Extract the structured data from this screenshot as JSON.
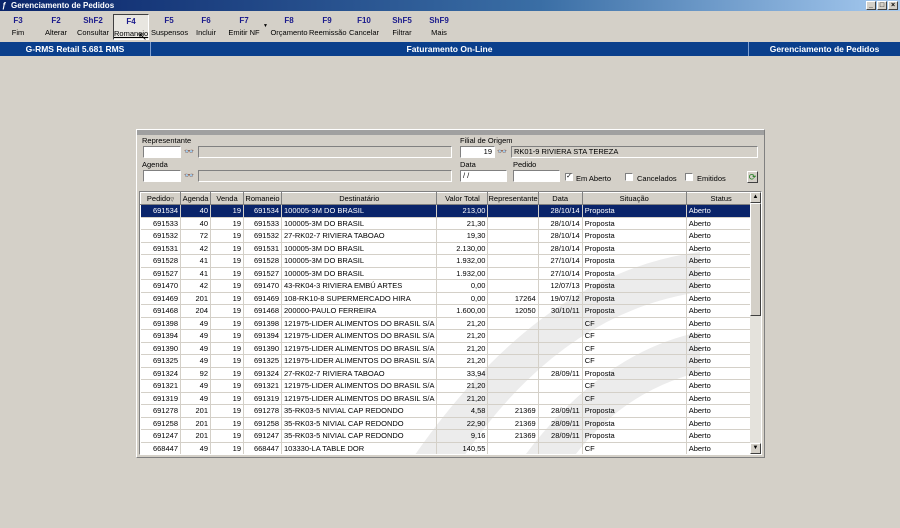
{
  "window": {
    "title": "Gerenciamento de Pedidos",
    "min": "_",
    "max": "□",
    "close": "×"
  },
  "toolbar": [
    {
      "key": "F3",
      "label": "Fim"
    },
    {
      "key": "F2",
      "label": "Alterar"
    },
    {
      "key": "ShF2",
      "label": "Consultar"
    },
    {
      "key": "F4",
      "label": "Romaneio"
    },
    {
      "key": "F5",
      "label": "Suspensos"
    },
    {
      "key": "F6",
      "label": "Incluir"
    },
    {
      "key": "F7",
      "label": "Emitir NF"
    },
    {
      "key": "F8",
      "label": "Orçamento"
    },
    {
      "key": "F9",
      "label": "Reemissão"
    },
    {
      "key": "F10",
      "label": "Cancelar"
    },
    {
      "key": "ShF5",
      "label": "Filtrar"
    },
    {
      "key": "ShF9",
      "label": "Mais"
    }
  ],
  "infobar": {
    "left": "G-RMS Retail 5.681 RMS",
    "center": "Faturamento On-Line",
    "right": "Gerenciamento de Pedidos"
  },
  "filters": {
    "representante_label": "Representante",
    "representante_value": "",
    "filial_label": "Filial de Origem",
    "filial_value": "19",
    "filial_desc": "RK01-9 RIVIERA STA TEREZA",
    "agenda_label": "Agenda",
    "agenda_value": "",
    "data_label": "Data",
    "data_value": " / /",
    "pedido_label": "Pedido",
    "pedido_value": "",
    "em_aberto_label": "Em Aberto",
    "em_aberto_checked": "✓",
    "cancelados_label": "Cancelados",
    "emitidos_label": "Emitidos"
  },
  "grid": {
    "columns": [
      "Pedido",
      "Agenda",
      "Venda",
      "Romaneio",
      "Destinatário",
      "Valor Total",
      "Representante",
      "Data",
      "Situação",
      "Status"
    ],
    "sort_indicator": "▽",
    "rows": [
      [
        "691534",
        "40",
        "19",
        "691534",
        "100005-3M DO BRASIL",
        "213,00",
        "",
        "28/10/14",
        "Proposta",
        "Aberto"
      ],
      [
        "691533",
        "40",
        "19",
        "691533",
        "100005-3M DO BRASIL",
        "21,30",
        "",
        "28/10/14",
        "Proposta",
        "Aberto"
      ],
      [
        "691532",
        "72",
        "19",
        "691532",
        "27-RK02-7 RIVIERA TABOAO",
        "19,30",
        "",
        "28/10/14",
        "Proposta",
        "Aberto"
      ],
      [
        "691531",
        "42",
        "19",
        "691531",
        "100005-3M DO BRASIL",
        "2.130,00",
        "",
        "28/10/14",
        "Proposta",
        "Aberto"
      ],
      [
        "691528",
        "41",
        "19",
        "691528",
        "100005-3M DO BRASIL",
        "1.932,00",
        "",
        "27/10/14",
        "Proposta",
        "Aberto"
      ],
      [
        "691527",
        "41",
        "19",
        "691527",
        "100005-3M DO BRASIL",
        "1.932,00",
        "",
        "27/10/14",
        "Proposta",
        "Aberto"
      ],
      [
        "691470",
        "42",
        "19",
        "691470",
        "43-RK04-3 RIVIERA EMBÚ ARTES",
        "0,00",
        "",
        "12/07/13",
        "Proposta",
        "Aberto"
      ],
      [
        "691469",
        "201",
        "19",
        "691469",
        "108-RK10-8 SUPERMERCADO HIRA",
        "0,00",
        "17264",
        "19/07/12",
        "Proposta",
        "Aberto"
      ],
      [
        "691468",
        "204",
        "19",
        "691468",
        "200000-PAULO FERREIRA",
        "1.600,00",
        "12050",
        "30/10/11",
        "Proposta",
        "Aberto"
      ],
      [
        "691398",
        "49",
        "19",
        "691398",
        "121975-LIDER ALIMENTOS DO BRASIL S/A",
        "21,20",
        "",
        "",
        "CF",
        "Aberto"
      ],
      [
        "691394",
        "49",
        "19",
        "691394",
        "121975-LIDER ALIMENTOS DO BRASIL S/A",
        "21,20",
        "",
        "",
        "CF",
        "Aberto"
      ],
      [
        "691390",
        "49",
        "19",
        "691390",
        "121975-LIDER ALIMENTOS DO BRASIL S/A",
        "21,20",
        "",
        "",
        "CF",
        "Aberto"
      ],
      [
        "691325",
        "49",
        "19",
        "691325",
        "121975-LIDER ALIMENTOS DO BRASIL S/A",
        "21,20",
        "",
        "",
        "CF",
        "Aberto"
      ],
      [
        "691324",
        "92",
        "19",
        "691324",
        "27-RK02-7 RIVIERA TABOAO",
        "33,94",
        "",
        "28/09/11",
        "Proposta",
        "Aberto"
      ],
      [
        "691321",
        "49",
        "19",
        "691321",
        "121975-LIDER ALIMENTOS DO BRASIL S/A",
        "21,20",
        "",
        "",
        "CF",
        "Aberto"
      ],
      [
        "691319",
        "49",
        "19",
        "691319",
        "121975-LIDER ALIMENTOS DO BRASIL S/A",
        "21,20",
        "",
        "",
        "CF",
        "Aberto"
      ],
      [
        "691278",
        "201",
        "19",
        "691278",
        "35-RK03-5 NIVIAL CAP REDONDO",
        "4,58",
        "21369",
        "28/09/11",
        "Proposta",
        "Aberto"
      ],
      [
        "691258",
        "201",
        "19",
        "691258",
        "35-RK03-5 NIVIAL CAP REDONDO",
        "22,90",
        "21369",
        "28/09/11",
        "Proposta",
        "Aberto"
      ],
      [
        "691247",
        "201",
        "19",
        "691247",
        "35-RK03-5 NIVIAL CAP REDONDO",
        "9,16",
        "21369",
        "28/09/11",
        "Proposta",
        "Aberto"
      ],
      [
        "668447",
        "49",
        "19",
        "668447",
        "103330-LA TABLE DOR",
        "140,55",
        "",
        "",
        "CF",
        "Aberto"
      ]
    ]
  }
}
